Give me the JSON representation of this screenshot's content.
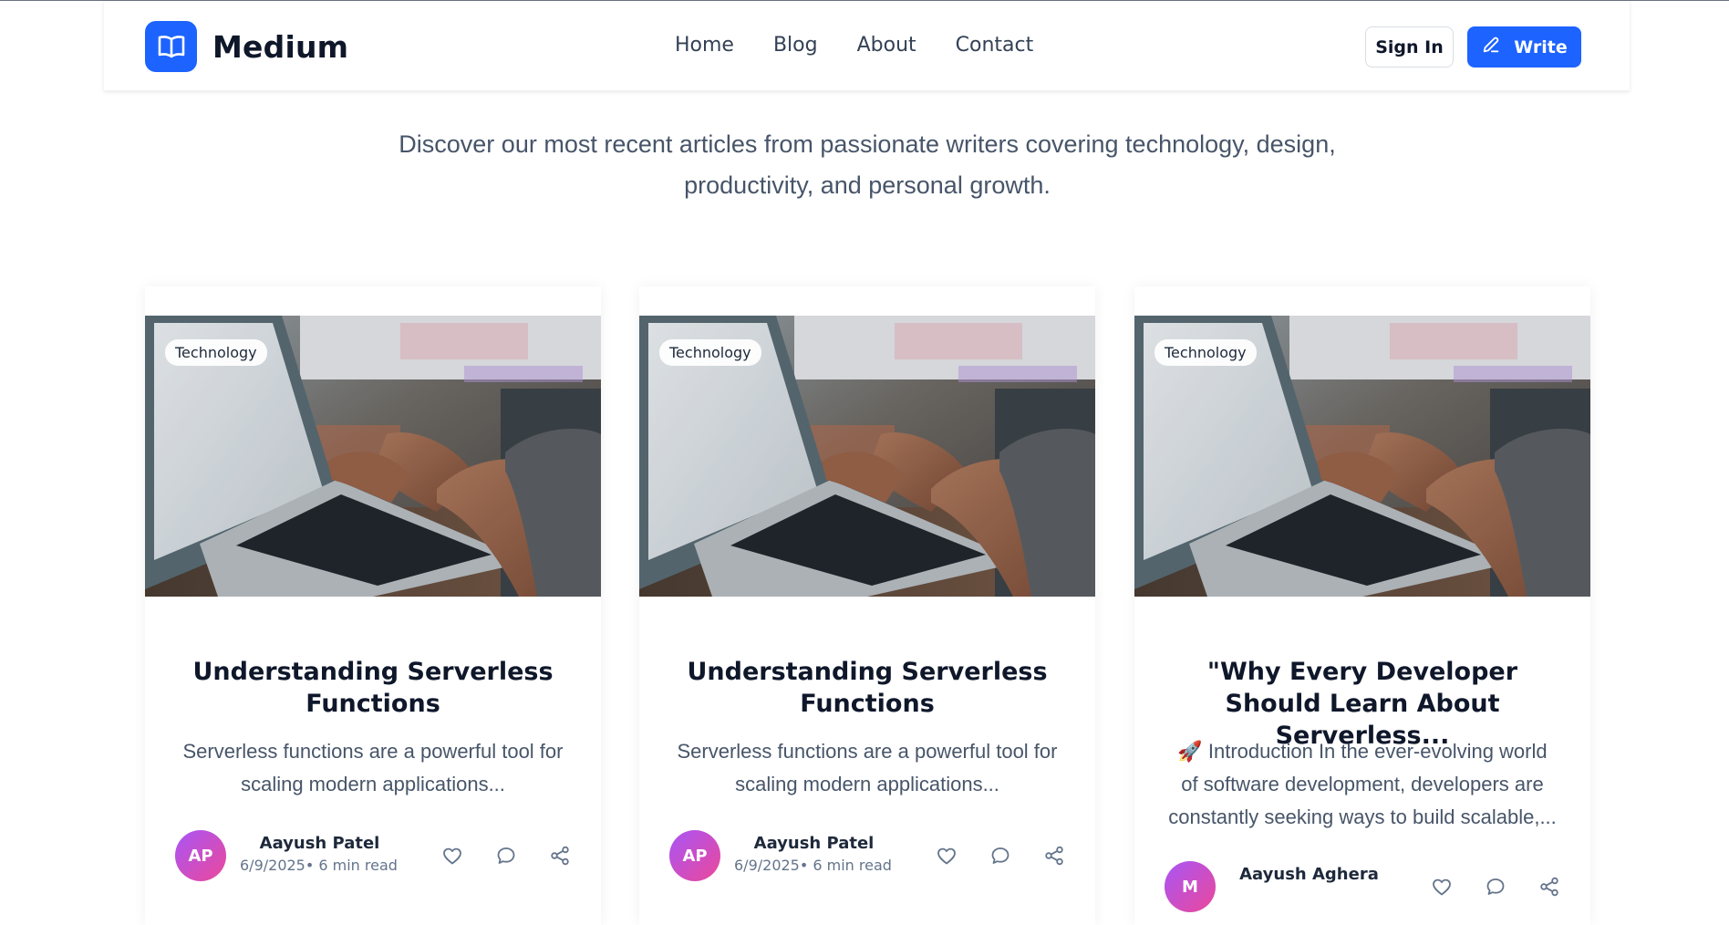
{
  "header": {
    "brand": "Medium",
    "nav": [
      "Home",
      "Blog",
      "About",
      "Contact"
    ],
    "sign_in_label": "Sign In",
    "write_label": "Write",
    "brand_color": "#1d63ff"
  },
  "hero": {
    "subtitle": "Discover our most recent articles from passionate writers covering technology, design, productivity, and personal growth."
  },
  "cards": [
    {
      "category": "Technology",
      "title": "Understanding Serverless Functions",
      "excerpt": "Serverless functions are a powerful tool for scaling modern applications...",
      "initials": "AP",
      "author": "Aayush Patel",
      "date": "6/9/2025",
      "read_time": "• 6 min read"
    },
    {
      "category": "Technology",
      "title": "Understanding Serverless Functions",
      "excerpt": "Serverless functions are a powerful tool for scaling modern applications...",
      "initials": "AP",
      "author": "Aayush Patel",
      "date": "6/9/2025",
      "read_time": "• 6 min read"
    },
    {
      "category": "Technology",
      "title": "\"Why Every Developer Should Learn About Serverless...",
      "excerpt": "🚀 Introduction In the ever-evolving world of software development, developers are constantly seeking ways to build scalable,...",
      "initials": "M",
      "author": "Aayush Aghera",
      "date": "",
      "read_time": ""
    }
  ],
  "icons": {
    "brand": "book-open-icon",
    "write": "pencil-icon",
    "like": "heart-icon",
    "comment": "comment-icon",
    "share": "share-icon"
  }
}
